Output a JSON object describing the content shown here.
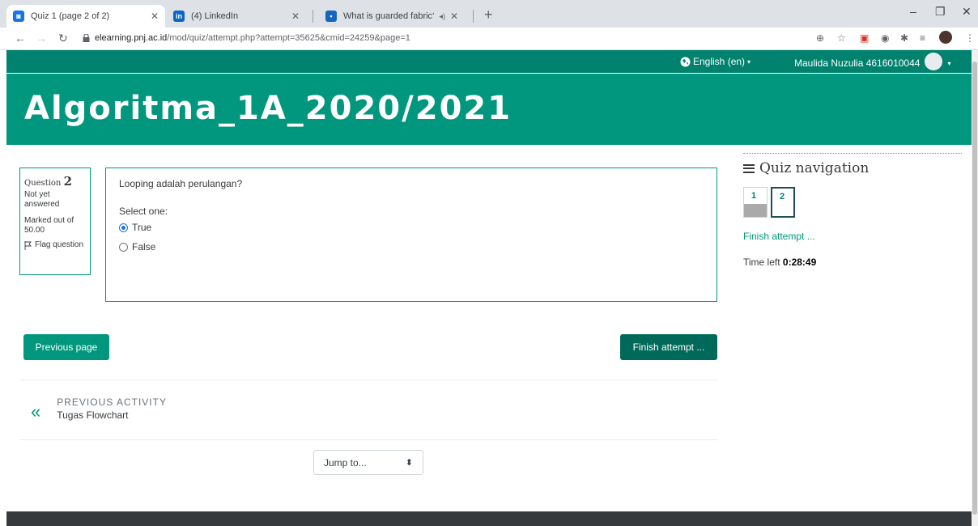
{
  "browser": {
    "tabs": [
      {
        "title": "Quiz 1 (page 2 of 2)",
        "favicon_color": "#1a73e8",
        "favicon_glyph": "◙"
      },
      {
        "title": "(4) LinkedIn",
        "favicon_color": "#0a66c2",
        "favicon_glyph": "in"
      },
      {
        "title": "What is guarded fabric?",
        "favicon_color": "#1565c0",
        "favicon_glyph": "▪"
      }
    ],
    "close_glyph": "✕",
    "new_tab_glyph": "+",
    "audio_glyph": "◂)",
    "url_host": "elearning.pnj.ac.id",
    "url_path": "/mod/quiz/attempt.php?attempt=35625&cmid=24259&page=1",
    "window_controls": {
      "minimize": "–",
      "restore": "❐",
      "close": "✕"
    }
  },
  "navbar": {
    "language": "English (en)",
    "user": "Maulida Nuzulia 4616010044",
    "caret": "▾"
  },
  "course_title": "Algoritma_1A_2020/2021",
  "question": {
    "label": "Question",
    "number": "2",
    "state": "Not yet answered",
    "mark": "Marked out of 50.00",
    "flag": "Flag question",
    "text": "Looping adalah perulangan?",
    "prompt": "Select one:",
    "options": [
      {
        "label": "True",
        "selected": true
      },
      {
        "label": "False",
        "selected": false
      }
    ]
  },
  "buttons": {
    "previous": "Previous page",
    "finish": "Finish attempt ..."
  },
  "previous_activity": {
    "label": "PREVIOUS ACTIVITY",
    "name": "Tugas Flowchart",
    "arrow": "«"
  },
  "jump": {
    "label": "Jump to...",
    "caret": "⬍"
  },
  "quiz_nav": {
    "title": "Quiz navigation",
    "questions": [
      {
        "num": "1",
        "answered": true,
        "current": false
      },
      {
        "num": "2",
        "answered": false,
        "current": true
      }
    ],
    "finish": "Finish attempt ...",
    "time_label": "Time left",
    "time_value": "0:28:49"
  },
  "colors": {
    "primary": "#00977e",
    "navbar": "#00826f",
    "dark_button": "#006a5a"
  }
}
